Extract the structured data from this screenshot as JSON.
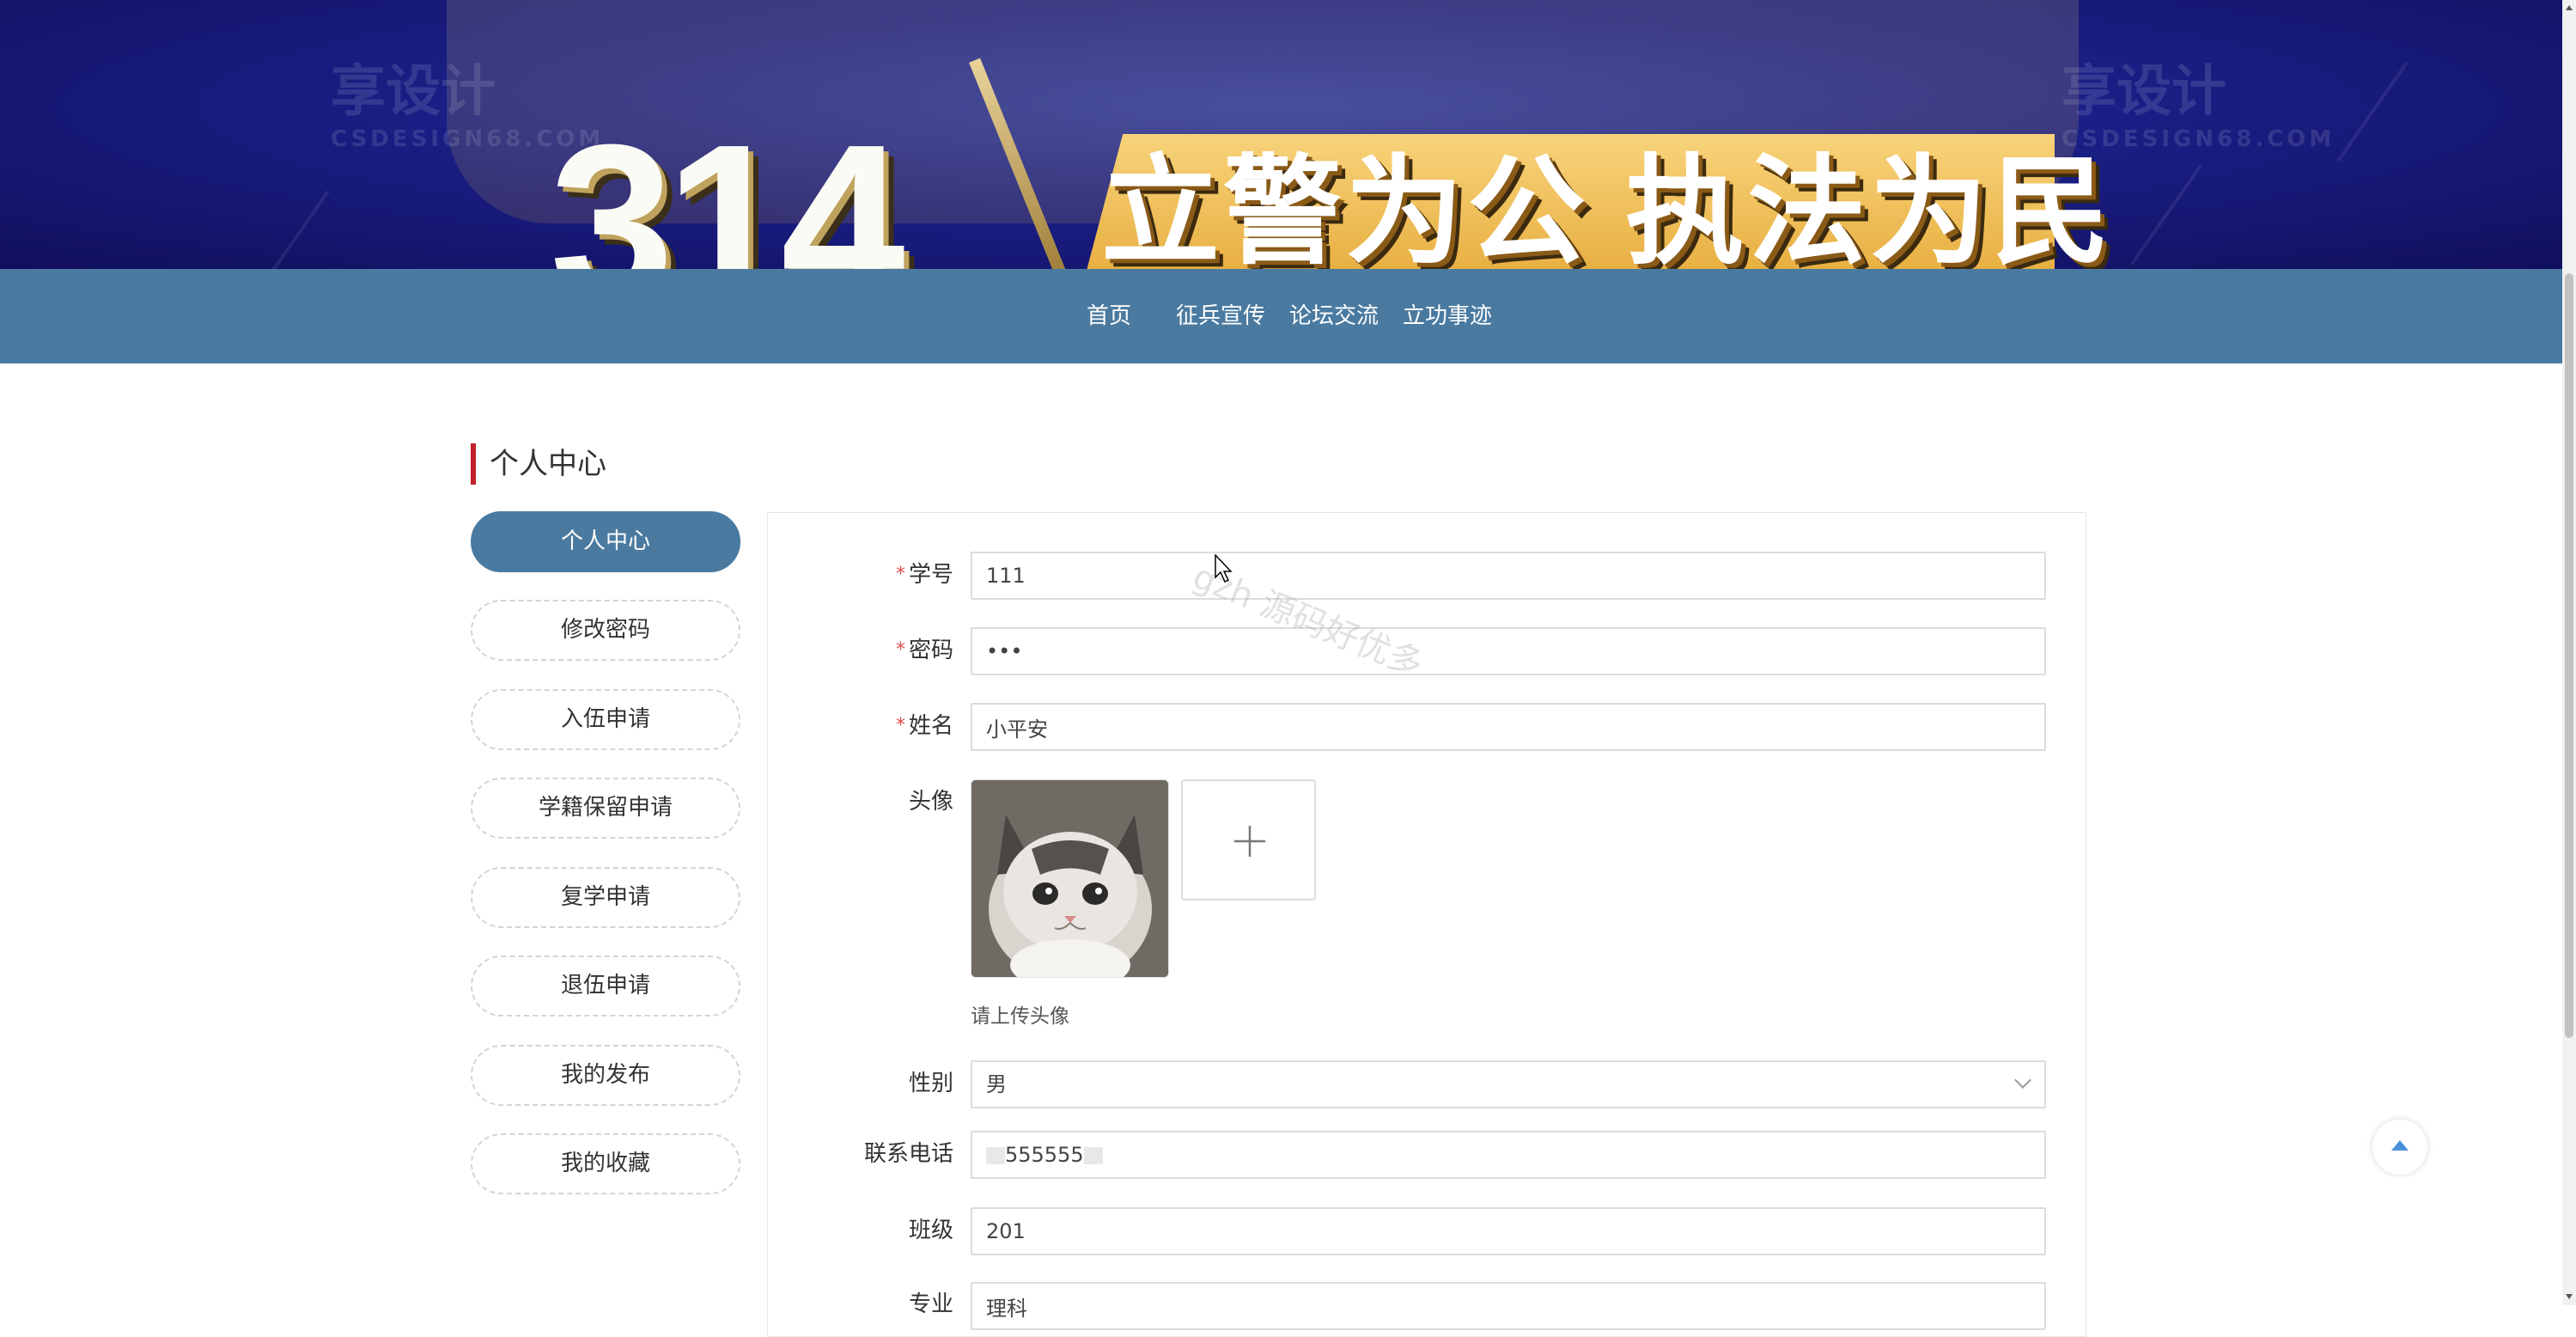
{
  "banner": {
    "digits": "314",
    "slogan": "立警为公 执法为民",
    "watermark_left": "享设计",
    "watermark_left_sub": "CSDESIGN68.COM",
    "watermark_right": "享设计",
    "watermark_right_sub": "CSDESIGN68.COM"
  },
  "nav": {
    "items": [
      {
        "label": "首页"
      },
      {
        "label": "征兵宣传"
      },
      {
        "label": "论坛交流"
      },
      {
        "label": "立功事迹"
      }
    ]
  },
  "section": {
    "title": "个人中心"
  },
  "menu": {
    "items": [
      {
        "label": "个人中心",
        "active": true
      },
      {
        "label": "修改密码"
      },
      {
        "label": "入伍申请"
      },
      {
        "label": "学籍保留申请"
      },
      {
        "label": "复学申请"
      },
      {
        "label": "退伍申请"
      },
      {
        "label": "我的发布"
      },
      {
        "label": "我的收藏"
      }
    ]
  },
  "form": {
    "required_mark": "*",
    "student_id": {
      "label": "学号",
      "value": "111"
    },
    "password": {
      "label": "密码",
      "value": "•••"
    },
    "name": {
      "label": "姓名",
      "value": "小平安"
    },
    "avatar": {
      "label": "头像",
      "hint": "请上传头像"
    },
    "gender": {
      "label": "性别",
      "value": "男"
    },
    "phone": {
      "label": "联系电话",
      "value": "555555"
    },
    "class": {
      "label": "班级",
      "value": "201"
    },
    "major": {
      "label": "专业",
      "value": "理科"
    }
  },
  "overlay_watermark": "gzh 源码好优多",
  "colors": {
    "navbar": "#4a7aa0",
    "accent_bar": "#c0212a",
    "required": "#e24b4b",
    "back_top_arrow": "#4a90d9"
  }
}
